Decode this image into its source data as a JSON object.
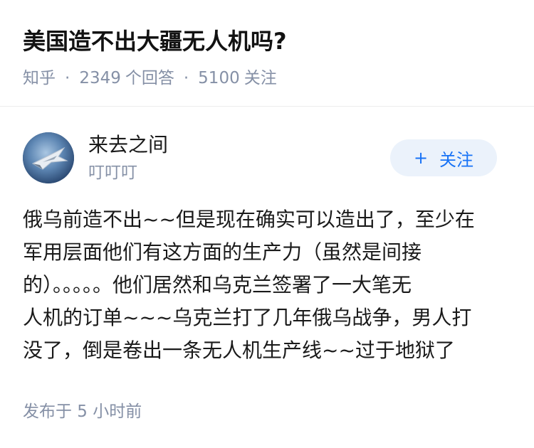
{
  "question": {
    "title": "美国造不出大疆无人机吗?",
    "source": "知乎",
    "separator": "·",
    "answer_count": "2349",
    "answer_unit": "个回答",
    "follower_count": "5100",
    "follower_unit": "关注"
  },
  "author": {
    "avatar_icon": "jet-avatar-icon",
    "name": "来去之间",
    "headline": "叮叮叮",
    "follow_plus": "+",
    "follow_label": "关注"
  },
  "answer": {
    "lines": [
      "俄乌前造不出~~但是现在确实可以造出了，至少在",
      "军用层面他们有这方面的生产力（虽然是间接",
      "的）。。。。。他们居然和乌克兰签署了一大笔无",
      "人机的订单~~~乌克兰打了几年俄乌战争，男人打",
      "没了，倒是卷出一条无人机生产线~~过于地狱了"
    ]
  },
  "footer": {
    "publish_time": "发布于 5 小时前"
  },
  "colors": {
    "title": "#121212",
    "meta": "#8590a6",
    "accent": "#1772f6",
    "follow_bg": "#ebf2fb",
    "divider": "#ececec"
  }
}
